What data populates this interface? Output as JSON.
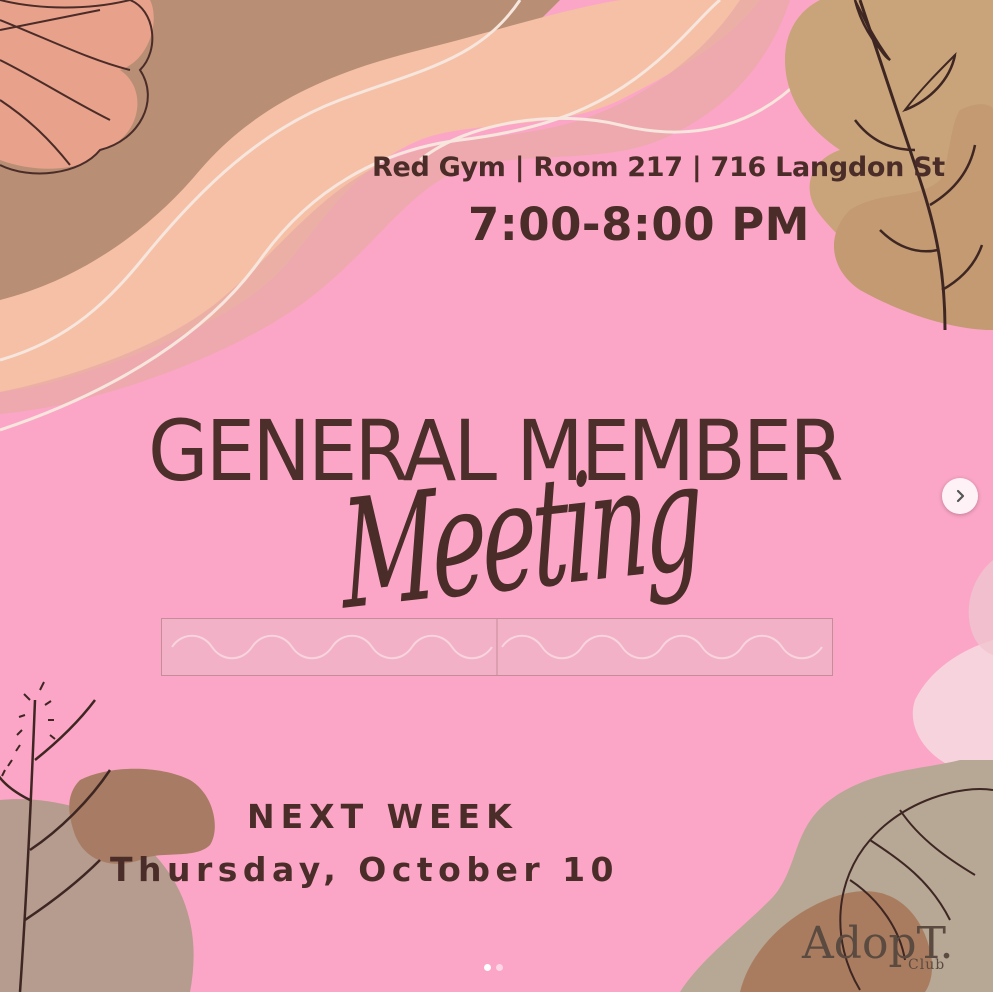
{
  "poster": {
    "location": "Red Gym | Room 217 | 716 Langdon St",
    "time": "7:00-8:00 PM",
    "headline": "GENERAL MEMBER",
    "script_word": "Meeting",
    "next_week": "NEXT WEEK",
    "date": "Thursday, October 10",
    "logo": "AdopT.",
    "logo_sub": "Club"
  },
  "carousel": {
    "next_icon": "chevron-right-icon",
    "pages": 2,
    "current_page": 1
  },
  "colors": {
    "background": "#fba6c6",
    "text": "#4a2c28",
    "accent_tan": "#c9a37a",
    "accent_brown": "#a67b62",
    "accent_peach": "#f6c3b0"
  }
}
